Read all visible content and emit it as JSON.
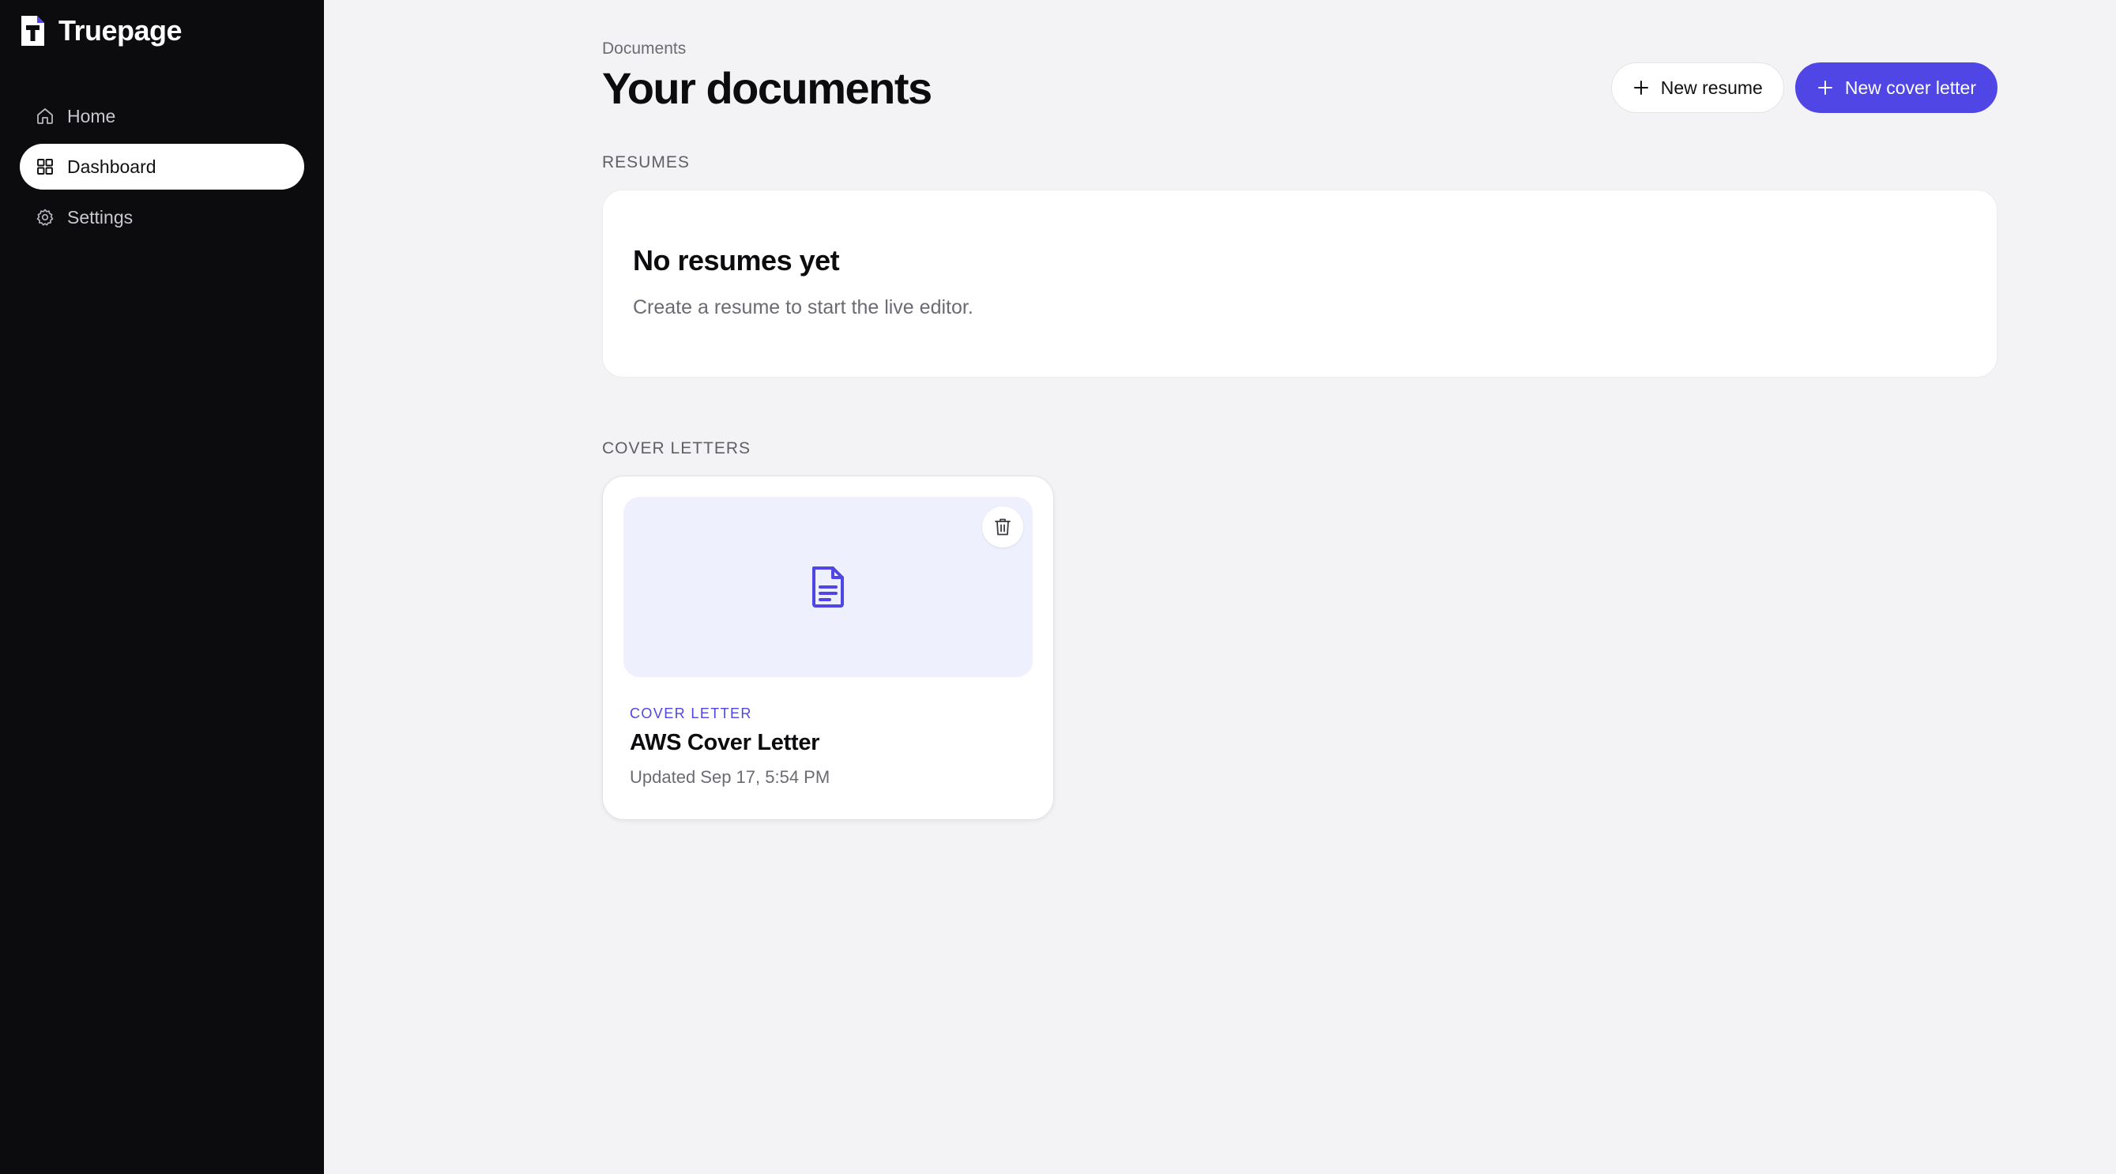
{
  "brand": {
    "name": "Truepage"
  },
  "sidebar": {
    "items": [
      {
        "label": "Home",
        "icon": "home-icon",
        "active": false
      },
      {
        "label": "Dashboard",
        "icon": "grid-icon",
        "active": true
      },
      {
        "label": "Settings",
        "icon": "gear-icon",
        "active": false
      }
    ]
  },
  "header": {
    "breadcrumb": "Documents",
    "title": "Your documents",
    "new_resume_label": "New resume",
    "new_cover_letter_label": "New cover letter"
  },
  "resumes": {
    "section_label": "RESUMES",
    "empty_title": "No resumes yet",
    "empty_text": "Create a resume to start the live editor."
  },
  "cover_letters": {
    "section_label": "COVER LETTERS",
    "items": [
      {
        "type_label": "COVER LETTER",
        "title": "AWS Cover Letter",
        "updated": "Updated Sep 17, 5:54 PM"
      }
    ]
  },
  "colors": {
    "sidebar_bg": "#0c0c0f",
    "accent": "#4f46e5",
    "page_bg": "#f3f3f5",
    "thumb_bg": "#eef0fd"
  }
}
